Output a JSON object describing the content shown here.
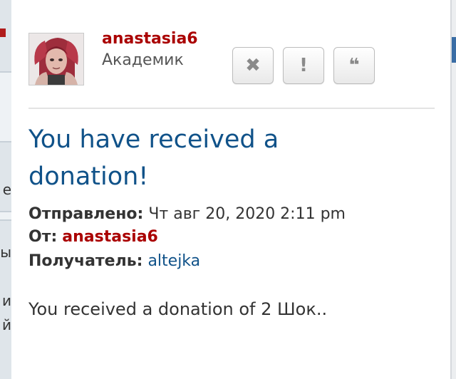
{
  "sidebar": {
    "clipped_glyphs": [
      "е",
      "ы",
      "и",
      "й"
    ]
  },
  "post": {
    "author": {
      "username": "anastasia6",
      "rank": "Академик",
      "username_color": "#aa0000"
    },
    "actions": [
      {
        "icon": "close-icon",
        "glyph": "✖"
      },
      {
        "icon": "exclamation-icon",
        "glyph": "!"
      },
      {
        "icon": "quote-icon",
        "glyph": "❝"
      }
    ],
    "title": "You have received a donation!",
    "meta": {
      "sent_label": "Отправлено:",
      "sent_value": "Чт авг 20, 2020 2:11 pm",
      "from_label": "От:",
      "from_value": "anastasia6",
      "to_label": "Получатель:",
      "to_value": "altejka"
    },
    "body": "You received a donation of 2 Шок.."
  },
  "colors": {
    "title": "#105289",
    "text": "#333333",
    "link": "#105289",
    "author": "#aa0000"
  }
}
